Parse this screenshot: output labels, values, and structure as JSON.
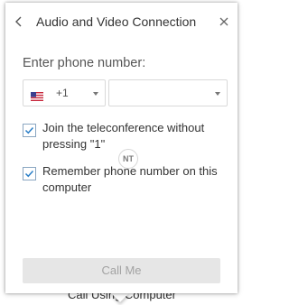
{
  "dialog": {
    "title": "Audio and Video Connection",
    "back_icon": "chevron-left-icon",
    "close_icon": "close-icon"
  },
  "phone": {
    "prompt": "Enter phone number:",
    "country_flag": "us-flag-icon",
    "country_code": "+1",
    "number_value": ""
  },
  "options": [
    {
      "label": "Join the teleconference without pressing \"1\"",
      "checked": true
    },
    {
      "label": "Remember phone number on this computer",
      "checked": true
    }
  ],
  "watermark": {
    "text": "NT"
  },
  "call_button": {
    "label": "Call Me",
    "enabled": false
  },
  "underlay": {
    "label": "Call Using Computer"
  },
  "colors": {
    "check": "#2a7fc8",
    "button_bg": "#e6e6e6",
    "button_text": "#a3a3a3"
  }
}
